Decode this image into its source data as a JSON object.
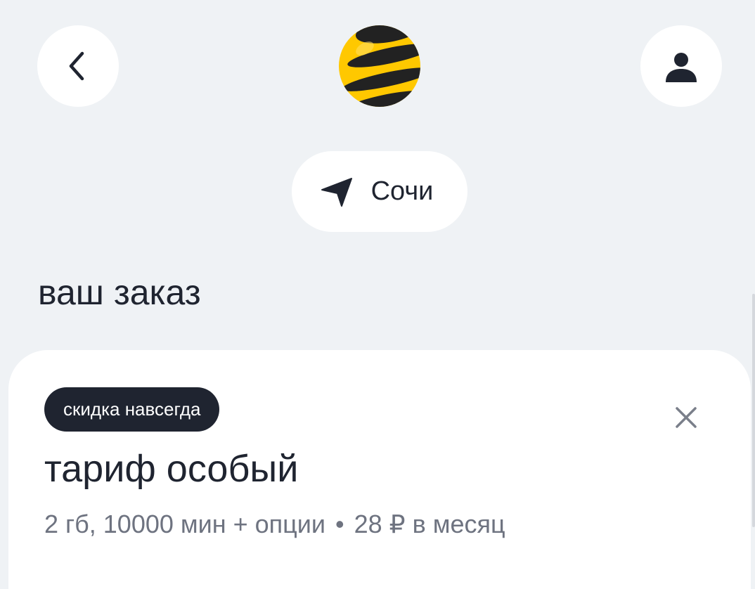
{
  "header": {
    "back_icon": "chevron-left-icon",
    "logo": "beeline-logo",
    "profile_icon": "user-icon"
  },
  "location": {
    "icon": "navigation-arrow-icon",
    "city": "Сочи"
  },
  "order": {
    "title": "ваш заказ"
  },
  "tariff_card": {
    "badge": "скидка навсегда",
    "name": "тариф особый",
    "specs": "2 гб, 10000 мин + опции",
    "separator": "•",
    "price": "28 ₽ в месяц",
    "close_icon": "close-icon"
  },
  "colors": {
    "background": "#eff2f5",
    "surface": "#ffffff",
    "text_primary": "#1f2430",
    "text_secondary": "#6e7380",
    "brand_yellow": "#ffc800",
    "brand_black": "#222222"
  }
}
